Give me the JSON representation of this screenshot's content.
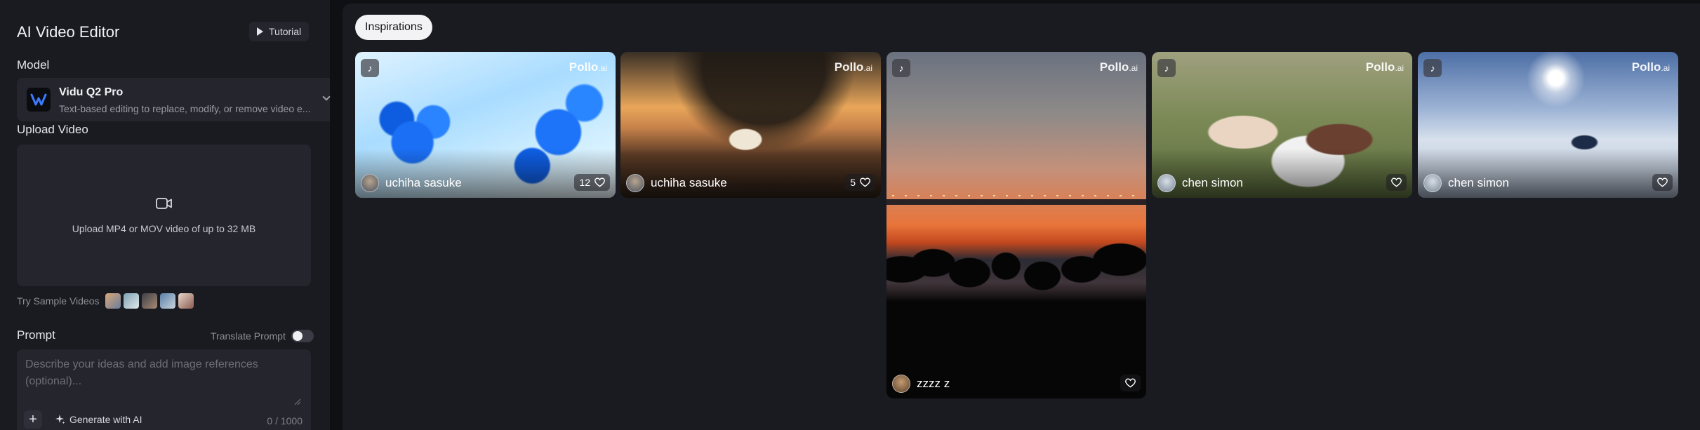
{
  "sidebar": {
    "title": "AI Video Editor",
    "tutorial_label": "Tutorial",
    "model_label": "Model",
    "model": {
      "name": "Vidu Q2 Pro",
      "description": "Text-based editing to replace, modify, or remove video e..."
    },
    "upload_label": "Upload Video",
    "upload_hint": "Upload MP4 or MOV video of up to 32 MB",
    "samples_label": "Try Sample Videos",
    "prompt_label": "Prompt",
    "translate_label": "Translate Prompt",
    "translate_enabled": false,
    "prompt_placeholder": "Describe your ideas and add image references (optional)...",
    "add_label": "+",
    "generate_label": "Generate with AI",
    "char_count": "0 / 1000"
  },
  "main": {
    "tab_label": "Inspirations",
    "watermark": "Pollo",
    "watermark_suffix": ".ai",
    "cards": [
      {
        "author": "uchiha sasuke",
        "likes": "12"
      },
      {
        "author": "uchiha sasuke",
        "likes": "5"
      },
      {
        "author": "zzzz z",
        "likes": ""
      },
      {
        "author": "chen simon",
        "likes": ""
      },
      {
        "author": "chen simon",
        "likes": ""
      }
    ]
  },
  "colors": {
    "page_bg": "#0f1014",
    "panel_bg": "#1a1b21",
    "field_bg": "#24252d",
    "chip_bg": "#f3f3f6"
  }
}
